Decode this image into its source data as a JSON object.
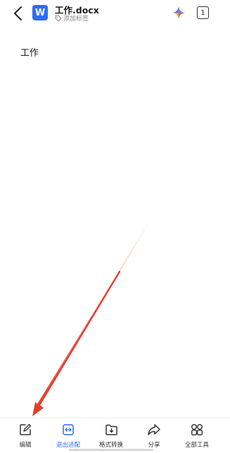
{
  "header": {
    "back_icon": "chevron-left-icon",
    "doc_type_letter": "W",
    "doc_type_color": "#2f6cf5",
    "title": "工作.docx",
    "tag_icon": "tag-icon",
    "tag_label": "添加标签",
    "ai_icon": "sparkle-icon",
    "page_count": "1"
  },
  "document": {
    "content": "工作"
  },
  "toolbar": {
    "items": [
      {
        "label": "编辑",
        "icon": "edit-icon",
        "active": false
      },
      {
        "label": "退出适配",
        "icon": "fit-width-icon",
        "active": true
      },
      {
        "label": "格式转换",
        "icon": "folder-convert-icon",
        "active": false
      },
      {
        "label": "分享",
        "icon": "share-icon",
        "active": false
      },
      {
        "label": "全部工具",
        "icon": "all-tools-icon",
        "active": false
      }
    ]
  },
  "colors": {
    "accent": "#2f6cf5",
    "annotation_arrow": "#e53b2e"
  }
}
